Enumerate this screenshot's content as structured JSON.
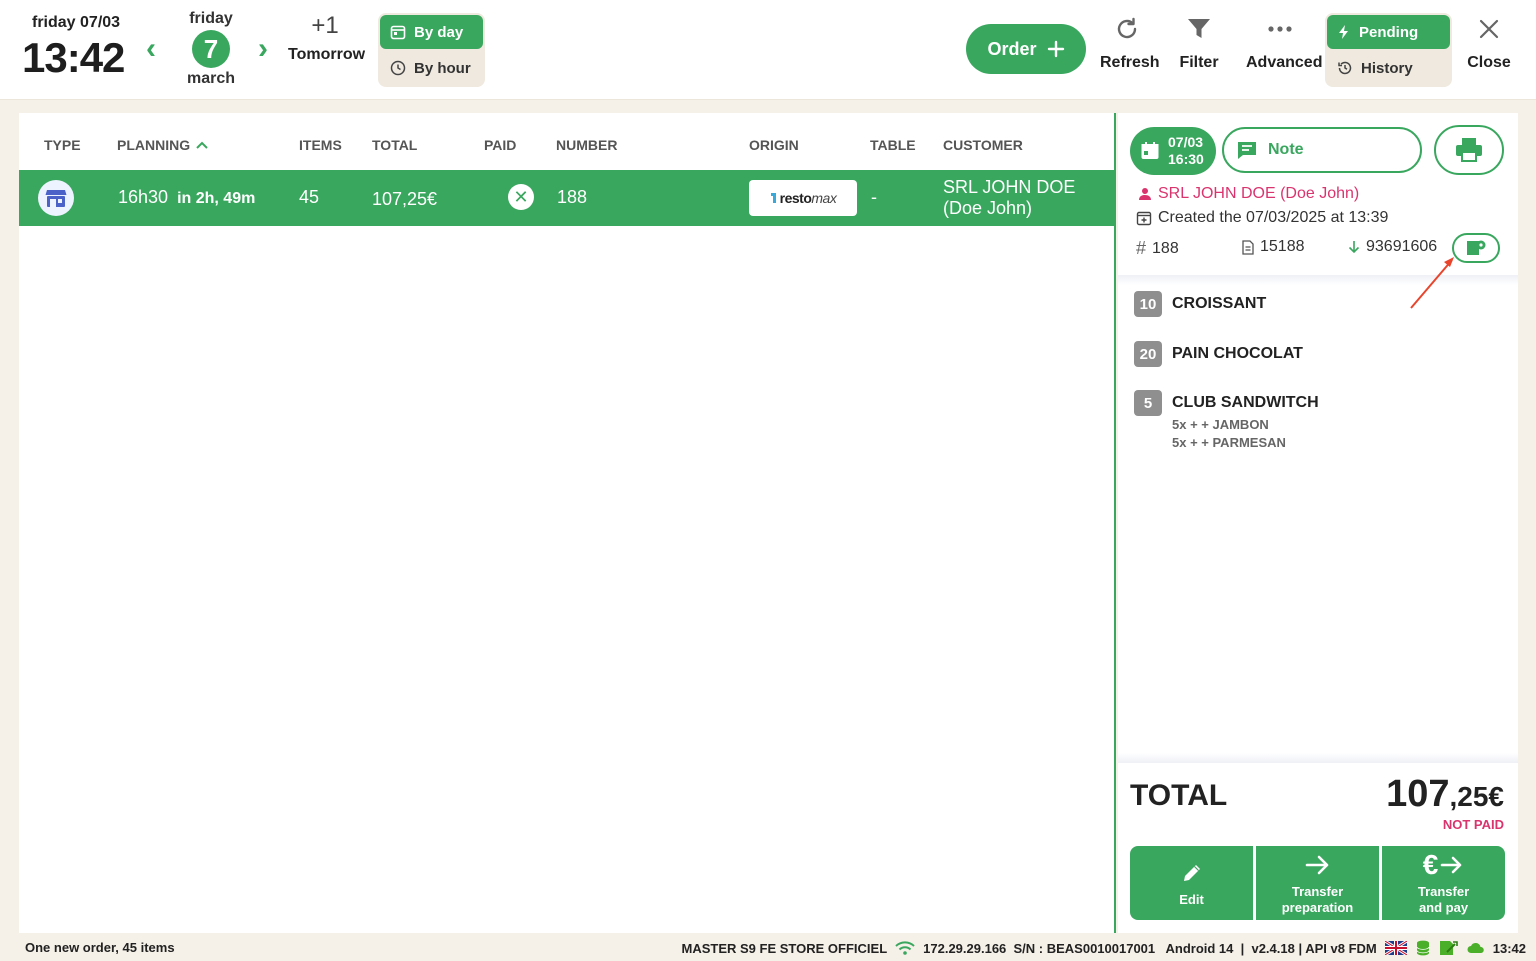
{
  "header": {
    "date_label": "friday 07/03",
    "time": "13:42",
    "calendar": {
      "weekday": "friday",
      "day": "7",
      "month": "march"
    },
    "tomorrow": {
      "offset": "+1",
      "label": "Tomorrow"
    },
    "view_toggle": {
      "by_day": "By day",
      "by_hour": "By hour"
    },
    "order_button": "Order",
    "tools": {
      "refresh": "Refresh",
      "filter": "Filter",
      "advanced": "Advanced",
      "close": "Close"
    },
    "status_toggle": {
      "pending": "Pending",
      "history": "History"
    }
  },
  "table": {
    "columns": [
      "TYPE",
      "PLANNING",
      "ITEMS",
      "TOTAL",
      "PAID",
      "NUMBER",
      "ORIGIN",
      "TABLE",
      "CUSTOMER"
    ],
    "rows": [
      {
        "planning_time": "16h30",
        "planning_rel": "in 2h, 49m",
        "items": "45",
        "total": "107,25€",
        "number": "188",
        "origin_a": "resto",
        "origin_b": "max",
        "table": "-",
        "customer": "SRL JOHN DOE (Doe John)"
      }
    ]
  },
  "detail": {
    "pill_date": "07/03",
    "pill_time": "16:30",
    "note": "Note",
    "customer": "SRL JOHN DOE (Doe John)",
    "created": "Created the 07/03/2025 at 13:39",
    "order_number": "188",
    "doc_number": "15188",
    "phone": "93691606",
    "items": [
      {
        "qty": "10",
        "name": "CROISSANT",
        "mods": []
      },
      {
        "qty": "20",
        "name": "PAIN CHOCOLAT",
        "mods": []
      },
      {
        "qty": "5",
        "name": "CLUB SANDWITCH",
        "mods": [
          "5x + + JAMBON",
          "5x + + PARMESAN"
        ]
      }
    ],
    "total_label": "TOTAL",
    "total_int": "107",
    "total_dec": ",25€",
    "payment_status": "NOT PAID",
    "actions": {
      "edit": "Edit",
      "transfer_prep_1": "Transfer",
      "transfer_prep_2": "preparation",
      "transfer_pay_1": "Transfer",
      "transfer_pay_2": "and pay"
    }
  },
  "status_bar": {
    "message": "One new order, 45 items",
    "store": "MASTER S9 FE STORE OFFICIEL",
    "info": "172.29.29.166  S/N : BEAS0010017001   Android 14  |  v2.4.18 | API v8 FDM",
    "time": "13:42"
  },
  "colors": {
    "accent": "#3aa75f",
    "pink": "#d9346e",
    "background": "#f5f0e8",
    "annotation": "#e8452c"
  }
}
